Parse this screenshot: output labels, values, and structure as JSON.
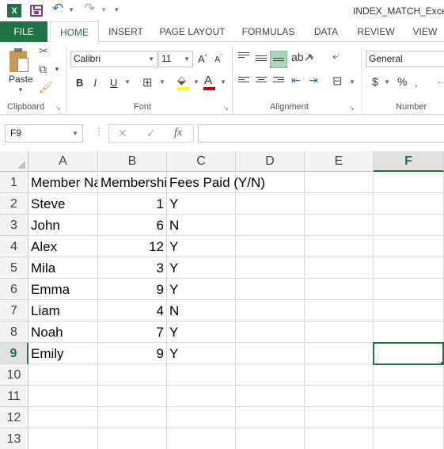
{
  "app": {
    "logo": "X",
    "file_title": "INDEX_MATCH_Excel_"
  },
  "tabs": [
    {
      "label": "FILE"
    },
    {
      "label": "HOME"
    },
    {
      "label": "INSERT"
    },
    {
      "label": "PAGE LAYOUT"
    },
    {
      "label": "FORMULAS"
    },
    {
      "label": "DATA"
    },
    {
      "label": "REVIEW"
    },
    {
      "label": "VIEW"
    }
  ],
  "ribbon": {
    "clipboard": {
      "paste_label": "Paste",
      "group_label": "Clipboard"
    },
    "font": {
      "font_name": "Calibri",
      "font_size": "11",
      "group_label": "Font",
      "fill_color": "#ffff00",
      "font_color": "#c00000"
    },
    "alignment": {
      "group_label": "Alignment"
    },
    "number": {
      "format": "General",
      "currency": "$",
      "percent": "%",
      "group_label": "Number"
    }
  },
  "formula_bar": {
    "name_box": "F9",
    "cancel": "✕",
    "enter": "✓",
    "fx": "fx",
    "formula": ""
  },
  "sheet": {
    "columns": [
      "A",
      "B",
      "C",
      "D",
      "E",
      "F"
    ],
    "selected_column": "F",
    "selected_row": "9",
    "active_cell": "F9",
    "rows": [
      {
        "num": "1",
        "cells": [
          "Member Name",
          "Membership",
          "Fees Paid (Y/N)",
          "",
          "",
          ""
        ]
      },
      {
        "num": "2",
        "cells": [
          "Steve",
          "1",
          "Y",
          "",
          "",
          ""
        ]
      },
      {
        "num": "3",
        "cells": [
          "John",
          "6",
          "N",
          "",
          "",
          ""
        ]
      },
      {
        "num": "4",
        "cells": [
          "Alex",
          "12",
          "Y",
          "",
          "",
          ""
        ]
      },
      {
        "num": "5",
        "cells": [
          "Mila",
          "3",
          "Y",
          "",
          "",
          ""
        ]
      },
      {
        "num": "6",
        "cells": [
          "Emma",
          "9",
          "Y",
          "",
          "",
          ""
        ]
      },
      {
        "num": "7",
        "cells": [
          "Liam",
          "4",
          "N",
          "",
          "",
          ""
        ]
      },
      {
        "num": "8",
        "cells": [
          "Noah",
          "7",
          "Y",
          "",
          "",
          ""
        ]
      },
      {
        "num": "9",
        "cells": [
          "Emily",
          "9",
          "Y",
          "",
          "",
          ""
        ]
      },
      {
        "num": "10",
        "cells": [
          "",
          "",
          "",
          "",
          "",
          ""
        ]
      },
      {
        "num": "11",
        "cells": [
          "",
          "",
          "",
          "",
          "",
          ""
        ]
      },
      {
        "num": "12",
        "cells": [
          "",
          "",
          "",
          "",
          "",
          ""
        ]
      },
      {
        "num": "13",
        "cells": [
          "",
          "",
          "",
          "",
          "",
          ""
        ]
      }
    ]
  }
}
